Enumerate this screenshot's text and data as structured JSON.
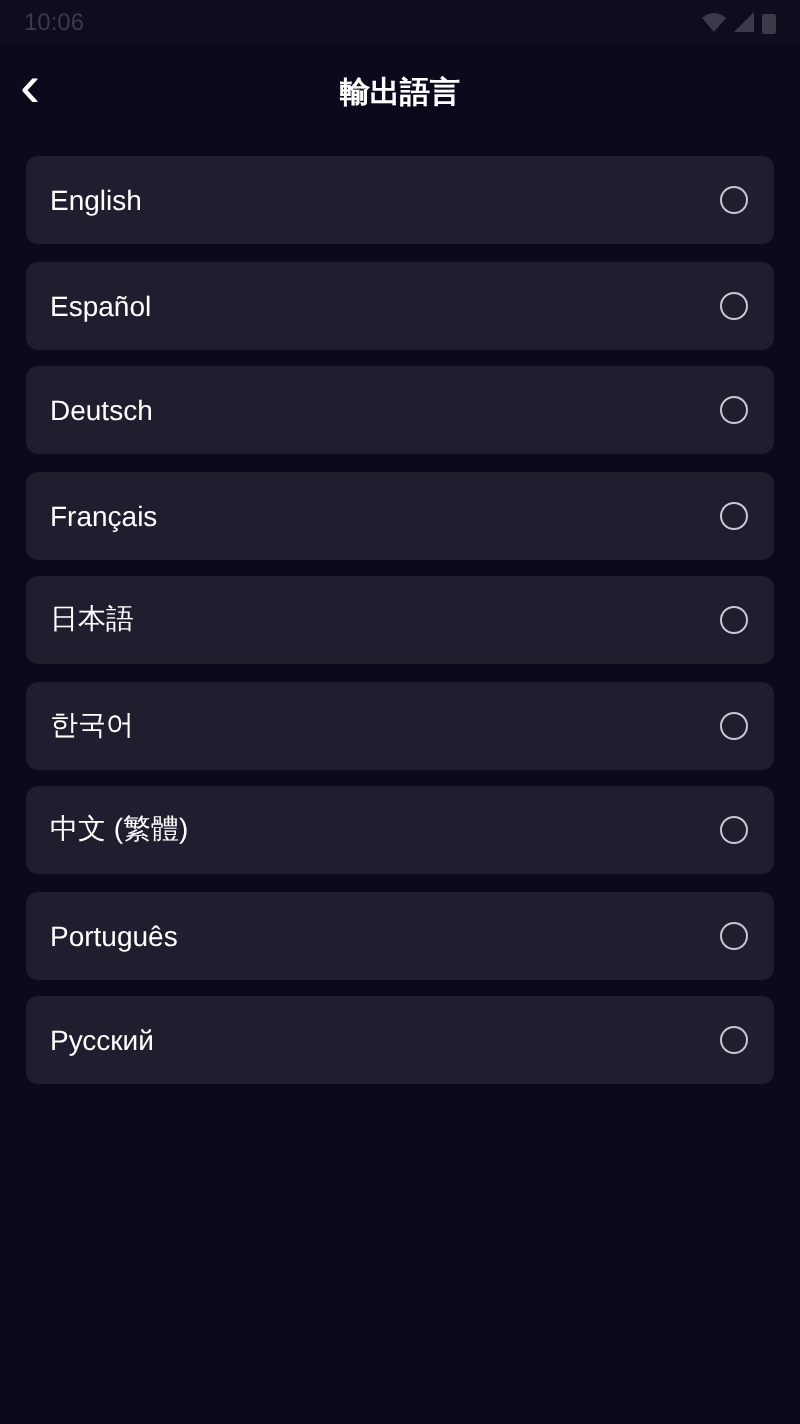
{
  "status_bar": {
    "time": "10:06"
  },
  "header": {
    "back": "‹",
    "title": "輸出語言"
  },
  "languages": [
    {
      "label": "English",
      "selected": false
    },
    {
      "label": "Español",
      "selected": false
    },
    {
      "label": "Deutsch",
      "selected": false
    },
    {
      "label": "Français",
      "selected": false
    },
    {
      "label": "日本語",
      "selected": false
    },
    {
      "label": "한국어",
      "selected": false
    },
    {
      "label": "中文 (繁體)",
      "selected": false
    },
    {
      "label": "Português",
      "selected": false
    },
    {
      "label": "Русский",
      "selected": false
    }
  ]
}
